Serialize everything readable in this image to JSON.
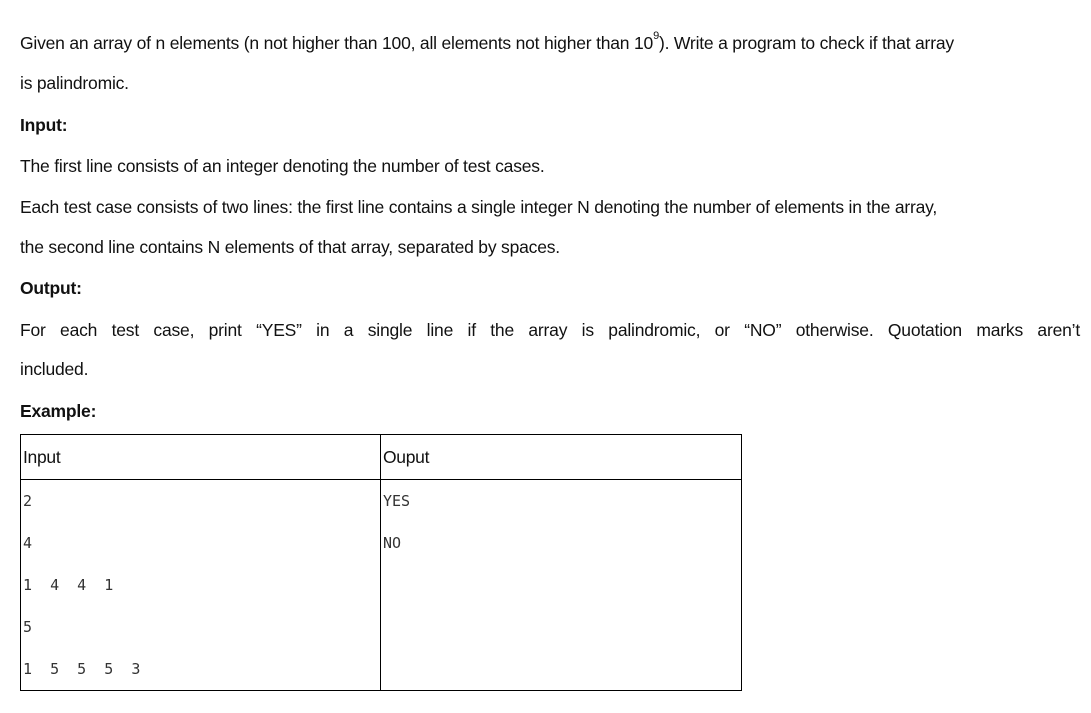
{
  "problem": {
    "line1_before_sup": "Given an array of n elements (n not higher than 100, all elements not higher than 10",
    "line1_sup": "9",
    "line1_after_sup": "). Write a program to check if that array",
    "line2": "is palindromic."
  },
  "input_section": {
    "heading": "Input:",
    "line1": "The first line consists of an integer denoting the number of test cases.",
    "line2": "Each test case consists of two lines: the first line contains a single integer N denoting the number of elements in the array,",
    "line3": "the second line contains N elements of that array, separated by spaces."
  },
  "output_section": {
    "heading": "Output:",
    "line1": "For each test case, print “YES” in a single line if the array is palindromic, or “NO” otherwise. Quotation marks aren’t",
    "line2": "included."
  },
  "example": {
    "heading": "Example:",
    "headers": [
      "Input",
      "Ouput"
    ],
    "rows": [
      [
        "2",
        "YES"
      ],
      [
        "4",
        "NO"
      ],
      [
        "1 4 4 1",
        ""
      ],
      [
        "5",
        ""
      ],
      [
        "1 5 5 5 3",
        ""
      ]
    ]
  }
}
